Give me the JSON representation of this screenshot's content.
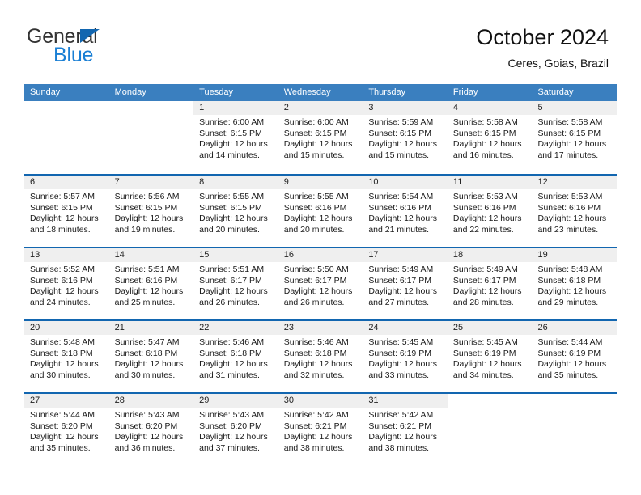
{
  "brand": {
    "name_top": "General",
    "name_bottom": "Blue",
    "accent_color": "#1a7fd4",
    "triangle_color": "#1266b0"
  },
  "header": {
    "title": "October 2024",
    "subtitle": "Ceres, Goias, Brazil"
  },
  "calendar": {
    "header_bg": "#3a7fbf",
    "row_divider_color": "#1266b0",
    "daynum_bg": "#efefef",
    "weekdays": [
      "Sunday",
      "Monday",
      "Tuesday",
      "Wednesday",
      "Thursday",
      "Friday",
      "Saturday"
    ],
    "weeks": [
      [
        {
          "day": "",
          "sunrise": "",
          "sunset": "",
          "daylight_1": "",
          "daylight_2": "",
          "blank": true
        },
        {
          "day": "",
          "sunrise": "",
          "sunset": "",
          "daylight_1": "",
          "daylight_2": "",
          "blank": true
        },
        {
          "day": "1",
          "sunrise": "Sunrise: 6:00 AM",
          "sunset": "Sunset: 6:15 PM",
          "daylight_1": "Daylight: 12 hours",
          "daylight_2": "and 14 minutes."
        },
        {
          "day": "2",
          "sunrise": "Sunrise: 6:00 AM",
          "sunset": "Sunset: 6:15 PM",
          "daylight_1": "Daylight: 12 hours",
          "daylight_2": "and 15 minutes."
        },
        {
          "day": "3",
          "sunrise": "Sunrise: 5:59 AM",
          "sunset": "Sunset: 6:15 PM",
          "daylight_1": "Daylight: 12 hours",
          "daylight_2": "and 15 minutes."
        },
        {
          "day": "4",
          "sunrise": "Sunrise: 5:58 AM",
          "sunset": "Sunset: 6:15 PM",
          "daylight_1": "Daylight: 12 hours",
          "daylight_2": "and 16 minutes."
        },
        {
          "day": "5",
          "sunrise": "Sunrise: 5:58 AM",
          "sunset": "Sunset: 6:15 PM",
          "daylight_1": "Daylight: 12 hours",
          "daylight_2": "and 17 minutes."
        }
      ],
      [
        {
          "day": "6",
          "sunrise": "Sunrise: 5:57 AM",
          "sunset": "Sunset: 6:15 PM",
          "daylight_1": "Daylight: 12 hours",
          "daylight_2": "and 18 minutes."
        },
        {
          "day": "7",
          "sunrise": "Sunrise: 5:56 AM",
          "sunset": "Sunset: 6:15 PM",
          "daylight_1": "Daylight: 12 hours",
          "daylight_2": "and 19 minutes."
        },
        {
          "day": "8",
          "sunrise": "Sunrise: 5:55 AM",
          "sunset": "Sunset: 6:15 PM",
          "daylight_1": "Daylight: 12 hours",
          "daylight_2": "and 20 minutes."
        },
        {
          "day": "9",
          "sunrise": "Sunrise: 5:55 AM",
          "sunset": "Sunset: 6:16 PM",
          "daylight_1": "Daylight: 12 hours",
          "daylight_2": "and 20 minutes."
        },
        {
          "day": "10",
          "sunrise": "Sunrise: 5:54 AM",
          "sunset": "Sunset: 6:16 PM",
          "daylight_1": "Daylight: 12 hours",
          "daylight_2": "and 21 minutes."
        },
        {
          "day": "11",
          "sunrise": "Sunrise: 5:53 AM",
          "sunset": "Sunset: 6:16 PM",
          "daylight_1": "Daylight: 12 hours",
          "daylight_2": "and 22 minutes."
        },
        {
          "day": "12",
          "sunrise": "Sunrise: 5:53 AM",
          "sunset": "Sunset: 6:16 PM",
          "daylight_1": "Daylight: 12 hours",
          "daylight_2": "and 23 minutes."
        }
      ],
      [
        {
          "day": "13",
          "sunrise": "Sunrise: 5:52 AM",
          "sunset": "Sunset: 6:16 PM",
          "daylight_1": "Daylight: 12 hours",
          "daylight_2": "and 24 minutes."
        },
        {
          "day": "14",
          "sunrise": "Sunrise: 5:51 AM",
          "sunset": "Sunset: 6:16 PM",
          "daylight_1": "Daylight: 12 hours",
          "daylight_2": "and 25 minutes."
        },
        {
          "day": "15",
          "sunrise": "Sunrise: 5:51 AM",
          "sunset": "Sunset: 6:17 PM",
          "daylight_1": "Daylight: 12 hours",
          "daylight_2": "and 26 minutes."
        },
        {
          "day": "16",
          "sunrise": "Sunrise: 5:50 AM",
          "sunset": "Sunset: 6:17 PM",
          "daylight_1": "Daylight: 12 hours",
          "daylight_2": "and 26 minutes."
        },
        {
          "day": "17",
          "sunrise": "Sunrise: 5:49 AM",
          "sunset": "Sunset: 6:17 PM",
          "daylight_1": "Daylight: 12 hours",
          "daylight_2": "and 27 minutes."
        },
        {
          "day": "18",
          "sunrise": "Sunrise: 5:49 AM",
          "sunset": "Sunset: 6:17 PM",
          "daylight_1": "Daylight: 12 hours",
          "daylight_2": "and 28 minutes."
        },
        {
          "day": "19",
          "sunrise": "Sunrise: 5:48 AM",
          "sunset": "Sunset: 6:18 PM",
          "daylight_1": "Daylight: 12 hours",
          "daylight_2": "and 29 minutes."
        }
      ],
      [
        {
          "day": "20",
          "sunrise": "Sunrise: 5:48 AM",
          "sunset": "Sunset: 6:18 PM",
          "daylight_1": "Daylight: 12 hours",
          "daylight_2": "and 30 minutes."
        },
        {
          "day": "21",
          "sunrise": "Sunrise: 5:47 AM",
          "sunset": "Sunset: 6:18 PM",
          "daylight_1": "Daylight: 12 hours",
          "daylight_2": "and 30 minutes."
        },
        {
          "day": "22",
          "sunrise": "Sunrise: 5:46 AM",
          "sunset": "Sunset: 6:18 PM",
          "daylight_1": "Daylight: 12 hours",
          "daylight_2": "and 31 minutes."
        },
        {
          "day": "23",
          "sunrise": "Sunrise: 5:46 AM",
          "sunset": "Sunset: 6:18 PM",
          "daylight_1": "Daylight: 12 hours",
          "daylight_2": "and 32 minutes."
        },
        {
          "day": "24",
          "sunrise": "Sunrise: 5:45 AM",
          "sunset": "Sunset: 6:19 PM",
          "daylight_1": "Daylight: 12 hours",
          "daylight_2": "and 33 minutes."
        },
        {
          "day": "25",
          "sunrise": "Sunrise: 5:45 AM",
          "sunset": "Sunset: 6:19 PM",
          "daylight_1": "Daylight: 12 hours",
          "daylight_2": "and 34 minutes."
        },
        {
          "day": "26",
          "sunrise": "Sunrise: 5:44 AM",
          "sunset": "Sunset: 6:19 PM",
          "daylight_1": "Daylight: 12 hours",
          "daylight_2": "and 35 minutes."
        }
      ],
      [
        {
          "day": "27",
          "sunrise": "Sunrise: 5:44 AM",
          "sunset": "Sunset: 6:20 PM",
          "daylight_1": "Daylight: 12 hours",
          "daylight_2": "and 35 minutes."
        },
        {
          "day": "28",
          "sunrise": "Sunrise: 5:43 AM",
          "sunset": "Sunset: 6:20 PM",
          "daylight_1": "Daylight: 12 hours",
          "daylight_2": "and 36 minutes."
        },
        {
          "day": "29",
          "sunrise": "Sunrise: 5:43 AM",
          "sunset": "Sunset: 6:20 PM",
          "daylight_1": "Daylight: 12 hours",
          "daylight_2": "and 37 minutes."
        },
        {
          "day": "30",
          "sunrise": "Sunrise: 5:42 AM",
          "sunset": "Sunset: 6:21 PM",
          "daylight_1": "Daylight: 12 hours",
          "daylight_2": "and 38 minutes."
        },
        {
          "day": "31",
          "sunrise": "Sunrise: 5:42 AM",
          "sunset": "Sunset: 6:21 PM",
          "daylight_1": "Daylight: 12 hours",
          "daylight_2": "and 38 minutes."
        },
        {
          "day": "",
          "sunrise": "",
          "sunset": "",
          "daylight_1": "",
          "daylight_2": "",
          "blank": true
        },
        {
          "day": "",
          "sunrise": "",
          "sunset": "",
          "daylight_1": "",
          "daylight_2": "",
          "blank": true
        }
      ]
    ]
  }
}
